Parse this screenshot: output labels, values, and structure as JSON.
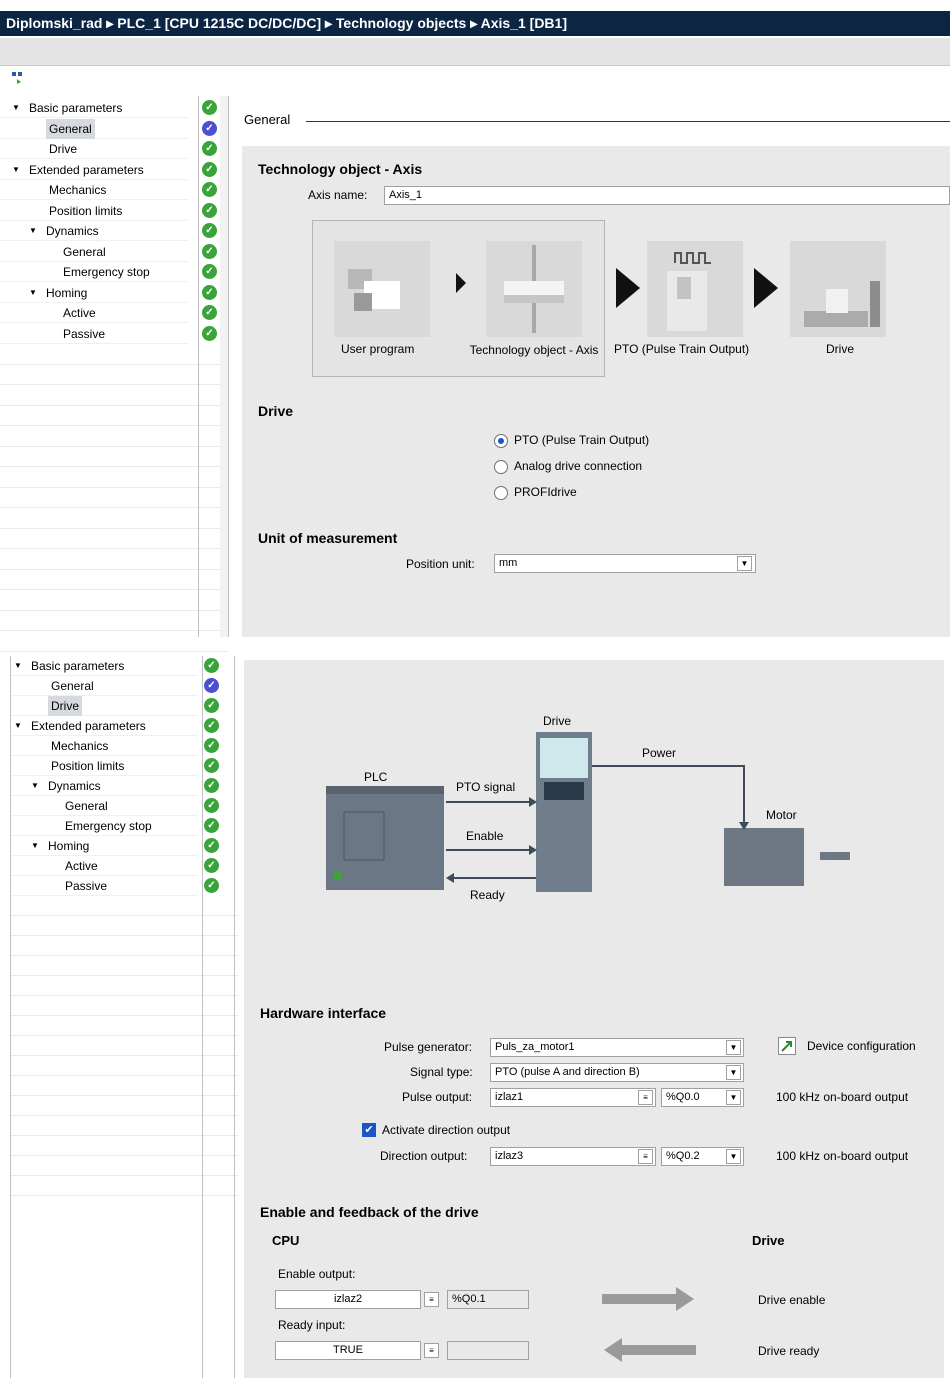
{
  "breadcrumb": {
    "path": "Diplomski_rad ▸ PLC_1 [CPU 1215C DC/DC/DC] ▸ Technology objects ▸ Axis_1 [DB1]"
  },
  "nav": {
    "items": [
      {
        "label": "Basic parameters",
        "indent": 0,
        "caret": true
      },
      {
        "label": "General",
        "indent": 1,
        "selected": true
      },
      {
        "label": "Drive",
        "indent": 1
      },
      {
        "label": "Extended parameters",
        "indent": 0,
        "caret": true
      },
      {
        "label": "Mechanics",
        "indent": 1
      },
      {
        "label": "Position limits",
        "indent": 1
      },
      {
        "label": "Dynamics",
        "indent": 1,
        "caret": true
      },
      {
        "label": "General",
        "indent": 2
      },
      {
        "label": "Emergency stop",
        "indent": 2
      },
      {
        "label": "Homing",
        "indent": 1,
        "caret": true
      },
      {
        "label": "Active",
        "indent": 2
      },
      {
        "label": "Passive",
        "indent": 2
      }
    ],
    "status": [
      "green",
      "blue",
      "green",
      "green",
      "green",
      "green",
      "green",
      "green",
      "green",
      "green",
      "green",
      "green"
    ]
  },
  "nav2": {
    "items": [
      {
        "label": "Basic parameters",
        "indent": 0,
        "caret": true
      },
      {
        "label": "General",
        "indent": 1
      },
      {
        "label": "Drive",
        "indent": 1,
        "selected": true
      },
      {
        "label": "Extended parameters",
        "indent": 0,
        "caret": true
      },
      {
        "label": "Mechanics",
        "indent": 1
      },
      {
        "label": "Position limits",
        "indent": 1
      },
      {
        "label": "Dynamics",
        "indent": 1,
        "caret": true
      },
      {
        "label": "General",
        "indent": 2
      },
      {
        "label": "Emergency stop",
        "indent": 2
      },
      {
        "label": "Homing",
        "indent": 1,
        "caret": true
      },
      {
        "label": "Active",
        "indent": 2
      },
      {
        "label": "Passive",
        "indent": 2
      }
    ]
  },
  "general": {
    "section_title": "General",
    "heading": "Technology object - Axis",
    "axis_name_label": "Axis name:",
    "axis_name_value": "Axis_1",
    "tiles": [
      "User program",
      "Technology object - Axis",
      "PTO (Pulse Train Output)",
      "Drive"
    ],
    "drive_heading": "Drive",
    "drive_options": [
      "PTO (Pulse Train Output)",
      "Analog drive connection",
      "PROFIdrive"
    ],
    "drive_selected": 0,
    "unit_heading": "Unit of measurement",
    "position_unit_label": "Position unit:",
    "position_unit_value": "mm"
  },
  "drive": {
    "diagram": {
      "drive": "Drive",
      "power": "Power",
      "plc": "PLC",
      "pto": "PTO signal",
      "enable": "Enable",
      "ready": "Ready",
      "motor": "Motor"
    },
    "hw_heading": "Hardware interface",
    "pulse_gen_label": "Pulse generator:",
    "pulse_gen_value": "Puls_za_motor1",
    "device_config": "Device configuration",
    "signal_type_label": "Signal type:",
    "signal_type_value": "PTO (pulse A and direction B)",
    "pulse_output_label": "Pulse output:",
    "pulse_output_value": "izlaz1",
    "pulse_output_addr": "%Q0.0",
    "onboard": "100 kHz on-board output",
    "activate_dir": "Activate direction output",
    "dir_output_label": "Direction output:",
    "dir_output_value": "izlaz3",
    "dir_output_addr": "%Q0.2",
    "enable_heading": "Enable and feedback of the drive",
    "cpu": "CPU",
    "drive_col": "Drive",
    "enable_output_label": "Enable output:",
    "enable_output_value": "izlaz2",
    "enable_output_addr": "%Q0.1",
    "drive_enable": "Drive enable",
    "ready_input_label": "Ready input:",
    "ready_input_value": "TRUE",
    "drive_ready": "Drive ready"
  }
}
